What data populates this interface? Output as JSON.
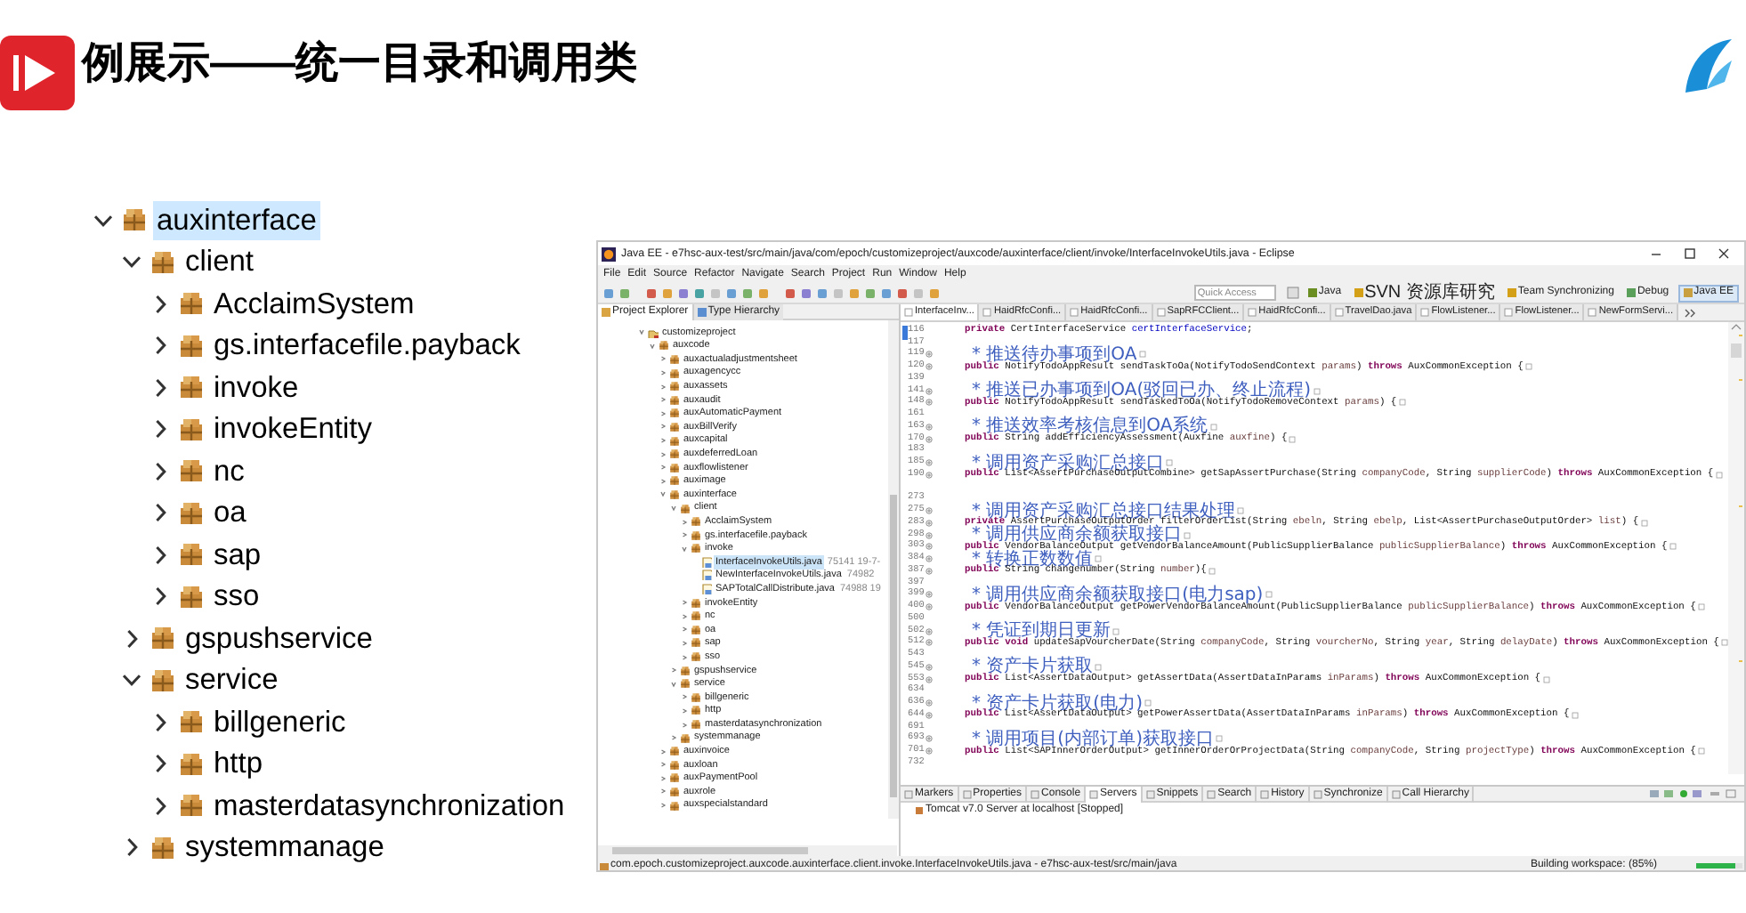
{
  "slide_title": "例展示——统一目录和调用类",
  "package_tree": [
    {
      "label": "auxinterface",
      "selected": true,
      "expanded": true,
      "children": [
        {
          "label": "client",
          "selected": false,
          "expanded": true,
          "children": [
            {
              "label": "AcclaimSystem",
              "selected": false,
              "expanded": false
            },
            {
              "label": "gs.interfacefile.payback",
              "selected": false,
              "expanded": false
            },
            {
              "label": "invoke",
              "selected": false,
              "expanded": false
            },
            {
              "label": "invokeEntity",
              "selected": false,
              "expanded": false
            },
            {
              "label": "nc",
              "selected": false,
              "expanded": false
            },
            {
              "label": "oa",
              "selected": false,
              "expanded": false
            },
            {
              "label": "sap",
              "selected": false,
              "expanded": false
            },
            {
              "label": "sso",
              "selected": false,
              "expanded": false
            }
          ]
        },
        {
          "label": "gspushservice",
          "selected": false,
          "expanded": false
        },
        {
          "label": "service",
          "selected": false,
          "expanded": true,
          "children": [
            {
              "label": "billgeneric",
              "selected": false,
              "expanded": false
            },
            {
              "label": "http",
              "selected": false,
              "expanded": false
            },
            {
              "label": "masterdatasynchronization",
              "selected": false,
              "expanded": false
            }
          ]
        },
        {
          "label": "systemmanage",
          "selected": false,
          "expanded": false
        }
      ]
    }
  ],
  "eclipse": {
    "window": {
      "title": "Java EE - e7hsc-aux-test/src/main/java/com/epoch/customizeproject/auxcode/auxinterface/client/invoke/InterfaceInvokeUtils.java - Eclipse"
    },
    "menu": [
      "File",
      "Edit",
      "Source",
      "Refactor",
      "Navigate",
      "Search",
      "Project",
      "Run",
      "Window",
      "Help"
    ],
    "quick_access": {
      "placeholder": "Quick Access"
    },
    "perspectives": [
      {
        "label": "Java",
        "selected": false
      },
      {
        "label": "SVN 资源库研究",
        "selected": false
      },
      {
        "label": "Team Synchronizing",
        "selected": false
      },
      {
        "label": "Debug",
        "selected": false
      },
      {
        "label": "Java EE",
        "selected": true
      }
    ],
    "explorer_tabs": [
      {
        "label": "Project Explorer",
        "selected": true
      },
      {
        "label": "Type Hierarchy",
        "selected": false
      }
    ],
    "explorer_tree": [
      {
        "label": "customizeproject",
        "kind": "project",
        "selected": false,
        "expanded": true,
        "children": [
          {
            "label": "auxcode",
            "kind": "package",
            "selected": false,
            "expanded": true,
            "children": [
              {
                "label": "auxactualadjustmentsheet",
                "kind": "package",
                "selected": false,
                "expanded": false
              },
              {
                "label": "auxagencycc",
                "kind": "package",
                "selected": false,
                "expanded": false
              },
              {
                "label": "auxassets",
                "kind": "package",
                "selected": false,
                "expanded": false
              },
              {
                "label": "auxaudit",
                "kind": "package",
                "selected": false,
                "expanded": false
              },
              {
                "label": "auxAutomaticPayment",
                "kind": "package",
                "selected": false,
                "expanded": false
              },
              {
                "label": "auxBillVerify",
                "kind": "package",
                "selected": false,
                "expanded": false
              },
              {
                "label": "auxcapital",
                "kind": "package",
                "selected": false,
                "expanded": false
              },
              {
                "label": "auxdeferredLoan",
                "kind": "package",
                "selected": false,
                "expanded": false
              },
              {
                "label": "auxflowlistener",
                "kind": "package",
                "selected": false,
                "expanded": false
              },
              {
                "label": "auximage",
                "kind": "package",
                "selected": false,
                "expanded": false
              },
              {
                "label": "auxinterface",
                "kind": "package",
                "selected": false,
                "expanded": true,
                "children": [
                  {
                    "label": "client",
                    "kind": "package",
                    "selected": false,
                    "expanded": true,
                    "children": [
                      {
                        "label": "AcclaimSystem",
                        "kind": "package",
                        "selected": false,
                        "expanded": false
                      },
                      {
                        "label": "gs.interfacefile.payback",
                        "kind": "package",
                        "selected": false,
                        "expanded": false
                      },
                      {
                        "label": "invoke",
                        "kind": "package",
                        "selected": false,
                        "expanded": true,
                        "children": [
                          {
                            "label": "InterfaceInvokeUtils.java",
                            "info": "75141  19-7-",
                            "kind": "java_file",
                            "selected": true
                          },
                          {
                            "label": "NewInterfaceInvokeUtils.java",
                            "info": "74982",
                            "kind": "java_file",
                            "selected": false
                          },
                          {
                            "label": "SAPTotalCallDistribute.java",
                            "info": "74988  19",
                            "kind": "java_file",
                            "selected": false
                          }
                        ]
                      },
                      {
                        "label": "invokeEntity",
                        "kind": "package",
                        "selected": false,
                        "expanded": false
                      },
                      {
                        "label": "nc",
                        "kind": "package",
                        "selected": false,
                        "expanded": false
                      },
                      {
                        "label": "oa",
                        "kind": "package",
                        "selected": false,
                        "expanded": false
                      },
                      {
                        "label": "sap",
                        "kind": "package",
                        "selected": false,
                        "expanded": false
                      },
                      {
                        "label": "sso",
                        "kind": "package",
                        "selected": false,
                        "expanded": false
                      }
                    ]
                  },
                  {
                    "label": "gspushservice",
                    "kind": "package",
                    "selected": false,
                    "expanded": false
                  },
                  {
                    "label": "service",
                    "kind": "package",
                    "selected": false,
                    "expanded": true,
                    "children": [
                      {
                        "label": "billgeneric",
                        "kind": "package",
                        "selected": false,
                        "expanded": false
                      },
                      {
                        "label": "http",
                        "kind": "package",
                        "selected": false,
                        "expanded": false
                      },
                      {
                        "label": "masterdatasynchronization",
                        "kind": "package",
                        "selected": false,
                        "expanded": false
                      }
                    ]
                  },
                  {
                    "label": "systemmanage",
                    "kind": "package",
                    "selected": false,
                    "expanded": false
                  }
                ]
              },
              {
                "label": "auxinvoice",
                "kind": "package",
                "selected": false,
                "expanded": false
              },
              {
                "label": "auxloan",
                "kind": "package",
                "selected": false,
                "expanded": false
              },
              {
                "label": "auxPaymentPool",
                "kind": "package",
                "selected": false,
                "expanded": false
              },
              {
                "label": "auxrole",
                "kind": "package",
                "selected": false,
                "expanded": false
              },
              {
                "label": "auxspecialstandard",
                "kind": "package",
                "selected": false,
                "expanded": false
              }
            ]
          }
        ]
      }
    ],
    "editor_tabs": [
      {
        "label": "InterfaceInv...",
        "selected": true
      },
      {
        "label": "HaidRfcConfi...",
        "selected": false
      },
      {
        "label": "HaidRfcConfi...",
        "selected": false
      },
      {
        "label": "SapRFCClient...",
        "selected": false
      },
      {
        "label": "HaidRfcConfi...",
        "selected": false
      },
      {
        "label": "TravelDao.java",
        "selected": false
      },
      {
        "label": "FlowListener...",
        "selected": false
      },
      {
        "label": "FlowListener...",
        "selected": false
      },
      {
        "label": "NewFormServi...",
        "selected": false
      }
    ],
    "code_lines": [
      {
        "number": "116",
        "kind": "code",
        "folded": false,
        "segments": [
          {
            "kind": "keyword",
            "text": "private"
          },
          {
            "kind": "plain",
            "text": " CertInterfaceService "
          },
          {
            "kind": "field",
            "text": "certInterfaceService"
          },
          {
            "kind": "plain",
            "text": ";"
          }
        ]
      },
      {
        "number": "117",
        "kind": "blank",
        "folded": false
      },
      {
        "number": "119",
        "kind": "comment",
        "folded": true,
        "text": "* 推送待办事项到OA"
      },
      {
        "number": "120",
        "kind": "code",
        "folded": true,
        "segments": [
          {
            "kind": "keyword",
            "text": "public"
          },
          {
            "kind": "plain",
            "text": " NotifyTodoAppResult sendTaskToOa(NotifyTodoSendContext "
          },
          {
            "kind": "param",
            "text": "params"
          },
          {
            "kind": "plain",
            "text": ") "
          },
          {
            "kind": "keyword",
            "text": "throws"
          },
          {
            "kind": "plain",
            "text": " AuxCommonException {"
          }
        ]
      },
      {
        "number": "139",
        "kind": "blank",
        "folded": false
      },
      {
        "number": "141",
        "kind": "comment",
        "folded": true,
        "text": "* 推送已办事项到OA(驳回已办、终止流程)"
      },
      {
        "number": "148",
        "kind": "code",
        "folded": true,
        "segments": [
          {
            "kind": "keyword",
            "text": "public"
          },
          {
            "kind": "plain",
            "text": " NotifyTodoAppResult sendTaskedToOa(NotifyTodoRemoveContext "
          },
          {
            "kind": "param",
            "text": "params"
          },
          {
            "kind": "plain",
            "text": ") {"
          }
        ]
      },
      {
        "number": "161",
        "kind": "blank",
        "folded": false
      },
      {
        "number": "163",
        "kind": "comment",
        "folded": true,
        "text": "* 推送效率考核信息到OA系统"
      },
      {
        "number": "170",
        "kind": "code",
        "folded": true,
        "segments": [
          {
            "kind": "keyword",
            "text": "public"
          },
          {
            "kind": "plain",
            "text": " String addEfficiencyAssessment(Auxfine "
          },
          {
            "kind": "param",
            "text": "auxfine"
          },
          {
            "kind": "plain",
            "text": ") {"
          }
        ]
      },
      {
        "number": "183",
        "kind": "blank",
        "folded": false
      },
      {
        "number": "185",
        "kind": "comment",
        "folded": true,
        "text": "* 调用资产采购汇总接口"
      },
      {
        "number": "190",
        "kind": "code",
        "folded": true,
        "segments": [
          {
            "kind": "keyword",
            "text": "public"
          },
          {
            "kind": "plain",
            "text": " List<AssertPurchaseOutputCombine> getSapAssertPurchase(String "
          },
          {
            "kind": "param",
            "text": "companyCode"
          },
          {
            "kind": "plain",
            "text": ", String "
          },
          {
            "kind": "param",
            "text": "supplierCode"
          },
          {
            "kind": "plain",
            "text": ") "
          },
          {
            "kind": "keyword",
            "text": "throws"
          },
          {
            "kind": "plain",
            "text": " AuxCommonException {"
          }
        ]
      },
      {
        "kind": "gap",
        "folded": false
      },
      {
        "number": "273",
        "kind": "blank",
        "folded": false
      },
      {
        "number": "275",
        "kind": "comment",
        "folded": true,
        "text": "* 调用资产采购汇总接口结果处理"
      },
      {
        "number": "283",
        "kind": "code",
        "folded": true,
        "segments": [
          {
            "kind": "keyword",
            "text": "private"
          },
          {
            "kind": "plain",
            "text": " AssertPurchaseOutputOrder filterOrderList(String "
          },
          {
            "kind": "param",
            "text": "ebeln"
          },
          {
            "kind": "plain",
            "text": ", String "
          },
          {
            "kind": "param",
            "text": "ebelp"
          },
          {
            "kind": "plain",
            "text": ", List<AssertPurchaseOutputOrder> "
          },
          {
            "kind": "param",
            "text": "list"
          },
          {
            "kind": "plain",
            "text": ") {"
          }
        ]
      },
      {
        "number": "298",
        "kind": "comment",
        "folded": true,
        "text": "* 调用供应商余额获取接口"
      },
      {
        "number": "303",
        "kind": "code",
        "folded": true,
        "segments": [
          {
            "kind": "keyword",
            "text": "public"
          },
          {
            "kind": "plain",
            "text": " VendorBalanceOutput getVendorBalanceAmount(PublicSupplierBalance "
          },
          {
            "kind": "param",
            "text": "publicSupplierBalance"
          },
          {
            "kind": "plain",
            "text": ") "
          },
          {
            "kind": "keyword",
            "text": "throws"
          },
          {
            "kind": "plain",
            "text": " AuxCommonException {"
          }
        ]
      },
      {
        "number": "384",
        "kind": "comment",
        "folded": true,
        "text": "* 转换正数数值"
      },
      {
        "number": "387",
        "kind": "code",
        "folded": true,
        "segments": [
          {
            "kind": "keyword",
            "text": "public"
          },
          {
            "kind": "plain",
            "text": " String changenumber(String "
          },
          {
            "kind": "param",
            "text": "number"
          },
          {
            "kind": "plain",
            "text": "){"
          }
        ]
      },
      {
        "number": "397",
        "kind": "blank",
        "folded": false
      },
      {
        "number": "399",
        "kind": "comment",
        "folded": true,
        "text": "* 调用供应商余额获取接口(电力sap)"
      },
      {
        "number": "400",
        "kind": "code",
        "folded": true,
        "segments": [
          {
            "kind": "keyword",
            "text": "public"
          },
          {
            "kind": "plain",
            "text": " VendorBalanceOutput getPowerVendorBalanceAmount(PublicSupplierBalance "
          },
          {
            "kind": "param",
            "text": "publicSupplierBalance"
          },
          {
            "kind": "plain",
            "text": ") "
          },
          {
            "kind": "keyword",
            "text": "throws"
          },
          {
            "kind": "plain",
            "text": " AuxCommonException {"
          }
        ]
      },
      {
        "number": "500",
        "kind": "blank",
        "folded": false
      },
      {
        "number": "502",
        "kind": "comment",
        "folded": true,
        "text": "* 凭证到期日更新"
      },
      {
        "number": "512",
        "kind": "code",
        "folded": true,
        "segments": [
          {
            "kind": "keyword",
            "text": "public void"
          },
          {
            "kind": "plain",
            "text": " updateSapVourcherDate(String "
          },
          {
            "kind": "param",
            "text": "companyCode"
          },
          {
            "kind": "plain",
            "text": ", String "
          },
          {
            "kind": "param",
            "text": "vourcherNo"
          },
          {
            "kind": "plain",
            "text": ", String "
          },
          {
            "kind": "param",
            "text": "year"
          },
          {
            "kind": "plain",
            "text": ", String "
          },
          {
            "kind": "param",
            "text": "delayDate"
          },
          {
            "kind": "plain",
            "text": ") "
          },
          {
            "kind": "keyword",
            "text": "throws"
          },
          {
            "kind": "plain",
            "text": " AuxCommonException {"
          }
        ]
      },
      {
        "number": "543",
        "kind": "blank",
        "folded": false
      },
      {
        "number": "545",
        "kind": "comment",
        "folded": true,
        "text": "* 资产卡片获取"
      },
      {
        "number": "553",
        "kind": "code",
        "folded": true,
        "segments": [
          {
            "kind": "keyword",
            "text": "public"
          },
          {
            "kind": "plain",
            "text": " List<AssertDataOutput> getAssertData(AssertDataInParams "
          },
          {
            "kind": "param",
            "text": "inParams"
          },
          {
            "kind": "plain",
            "text": ") "
          },
          {
            "kind": "keyword",
            "text": "throws"
          },
          {
            "kind": "plain",
            "text": " AuxCommonException {"
          }
        ]
      },
      {
        "number": "634",
        "kind": "blank",
        "folded": false
      },
      {
        "number": "636",
        "kind": "comment",
        "folded": true,
        "text": "* 资产卡片获取(电力)"
      },
      {
        "number": "644",
        "kind": "code",
        "folded": true,
        "segments": [
          {
            "kind": "keyword",
            "text": "public"
          },
          {
            "kind": "plain",
            "text": " List<AssertDataOutput> getPowerAssertData(AssertDataInParams "
          },
          {
            "kind": "param",
            "text": "inParams"
          },
          {
            "kind": "plain",
            "text": ") "
          },
          {
            "kind": "keyword",
            "text": "throws"
          },
          {
            "kind": "plain",
            "text": " AuxCommonException {"
          }
        ]
      },
      {
        "number": "691",
        "kind": "blank",
        "folded": false
      },
      {
        "number": "693",
        "kind": "comment",
        "folded": true,
        "text": "* 调用项目(内部订单)获取接口"
      },
      {
        "number": "701",
        "kind": "code",
        "folded": true,
        "segments": [
          {
            "kind": "keyword",
            "text": "public"
          },
          {
            "kind": "plain",
            "text": " List<SAPInnerOrderOutput> getInnerOrderOrProjectData(String "
          },
          {
            "kind": "param",
            "text": "companyCode"
          },
          {
            "kind": "plain",
            "text": ", String "
          },
          {
            "kind": "param",
            "text": "projectType"
          },
          {
            "kind": "plain",
            "text": ") "
          },
          {
            "kind": "keyword",
            "text": "throws"
          },
          {
            "kind": "plain",
            "text": " AuxCommonException {"
          }
        ]
      },
      {
        "number": "732",
        "kind": "blank",
        "folded": false
      }
    ],
    "bottom_tabs": [
      {
        "label": "Markers",
        "selected": false
      },
      {
        "label": "Properties",
        "selected": false
      },
      {
        "label": "Console",
        "selected": false
      },
      {
        "label": "Servers",
        "selected": true
      },
      {
        "label": "Snippets",
        "selected": false
      },
      {
        "label": "Search",
        "selected": false
      },
      {
        "label": "History",
        "selected": false
      },
      {
        "label": "Synchronize",
        "selected": false
      },
      {
        "label": "Call Hierarchy",
        "selected": false
      }
    ],
    "servers": [
      {
        "label": "Tomcat v7.0 Server at localhost  [Stopped]"
      }
    ],
    "status_bar": {
      "path": "com.epoch.customizeproject.auxcode.auxinterface.client.invoke.InterfaceInvokeUtils.java - e7hsc-aux-test/src/main/java",
      "task": "Building workspace: (85%)",
      "level": 0.85
    }
  }
}
